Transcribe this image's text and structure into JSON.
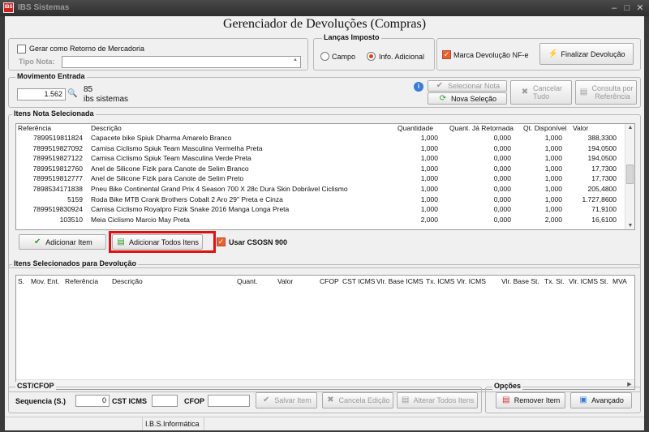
{
  "window": {
    "title": "IBS Sistemas",
    "icon_text": "IBS",
    "min": "–",
    "max": "□",
    "close": "✕"
  },
  "header": {
    "title": "Gerenciador de Devoluções (Compras)"
  },
  "top_panel": {
    "gerar_retorno_label": "Gerar como Retorno de Mercadoria",
    "tipo_nota_label": "Tipo Nota:",
    "tipo_nota_value": ""
  },
  "lancas": {
    "title": "Lanças Imposto",
    "campo_label": "Campo",
    "info_label": "Info. Adicional",
    "selected": "Info. Adicional"
  },
  "marca": {
    "label": "Marca Devolução NF-e",
    "checked": true
  },
  "finalizar_label": "Finalizar Devolução",
  "movimento": {
    "title": "Movimento Entrada",
    "value": "1.562",
    "count": "85",
    "company": "ibs sistemas"
  },
  "actions": {
    "selecionar_nota": "Selecionar Nota",
    "nova_selecao": "Nova Seleção",
    "cancelar_tudo": "Cancelar\nTudo",
    "consulta_ref": "Consulta por\nReferência"
  },
  "itens_nota": {
    "title": "Itens Nota Selecionada",
    "columns": [
      "Referência",
      "Descrição",
      "Quantidade",
      "Quant. Já Retornada",
      "Qt. Disponível",
      "Valor"
    ],
    "rows": [
      [
        "7899519811824",
        "Capacete bike Spiuk Dharma Amarelo Branco",
        "1,000",
        "0,000",
        "1,000",
        "388,3300"
      ],
      [
        "7899519827092",
        "Camisa Ciclismo Spiuk Team Masculina Vermelha Preta",
        "1,000",
        "0,000",
        "1,000",
        "194,0500"
      ],
      [
        "7899519827122",
        "Camisa Ciclismo Spiuk Team Masculina Verde Preta",
        "1,000",
        "0,000",
        "1,000",
        "194,0500"
      ],
      [
        "7899519812760",
        "Anel de Silicone Fizik para Canote de Selim Branco",
        "1,000",
        "0,000",
        "1,000",
        "17,7300"
      ],
      [
        "7899519812777",
        "Anel de Silicone Fizik para Canote de Selim Preto",
        "1,000",
        "0,000",
        "1,000",
        "17,7300"
      ],
      [
        "7898534171838",
        "Pneu Bike Continental Grand Prix 4 Season 700 X 28c Dura Skin Dobrável Ciclismo",
        "1,000",
        "0,000",
        "1,000",
        "205,4800"
      ],
      [
        "5159",
        "Roda Bike MTB Crank Brothers Cobalt 2 Aro 29\" Preta e Cinza",
        "1,000",
        "0,000",
        "1,000",
        "1.727,8600"
      ],
      [
        "7899519830924",
        "Camisa Ciclismo Royalpro Fizik Snake 2016 Manga Longa Preta",
        "1,000",
        "0,000",
        "1,000",
        "71,9100"
      ],
      [
        "103510",
        "Meia Ciclismo Marcio May Preta",
        "2,000",
        "0,000",
        "2,000",
        "16,6100"
      ]
    ]
  },
  "add_buttons": {
    "adicionar_item": "Adicionar Item",
    "adicionar_todos": "Adicionar Todos Itens",
    "usar_csosn": "Usar CSOSN 900"
  },
  "itens_devolucao": {
    "title": "Itens Selecionados para Devolução",
    "columns": [
      "S.",
      "Mov. Ent.",
      "Referência",
      "Descrição",
      "Quant.",
      "Valor",
      "CFOP",
      "CST ICMS",
      "Vlr. Base ICMS",
      "Tx. ICMS",
      "Vlr. ICMS",
      "Vlr. Base St.",
      "Tx. St.",
      "Vlr. ICMS St.",
      "MVA"
    ]
  },
  "cst_cfop": {
    "title": "CST/CFOP",
    "sequencia_label": "Sequencia (S.)",
    "sequencia_value": "0",
    "cst_label": "CST ICMS",
    "cfop_label": "CFOP",
    "salvar": "Salvar Item",
    "cancela": "Cancela Edição",
    "alterar": "Alterar Todos Itens"
  },
  "opcoes": {
    "title": "Opções",
    "remover": "Remover Item",
    "avancado": "Avançado"
  },
  "status": {
    "company": "I.B.S.Informática"
  }
}
